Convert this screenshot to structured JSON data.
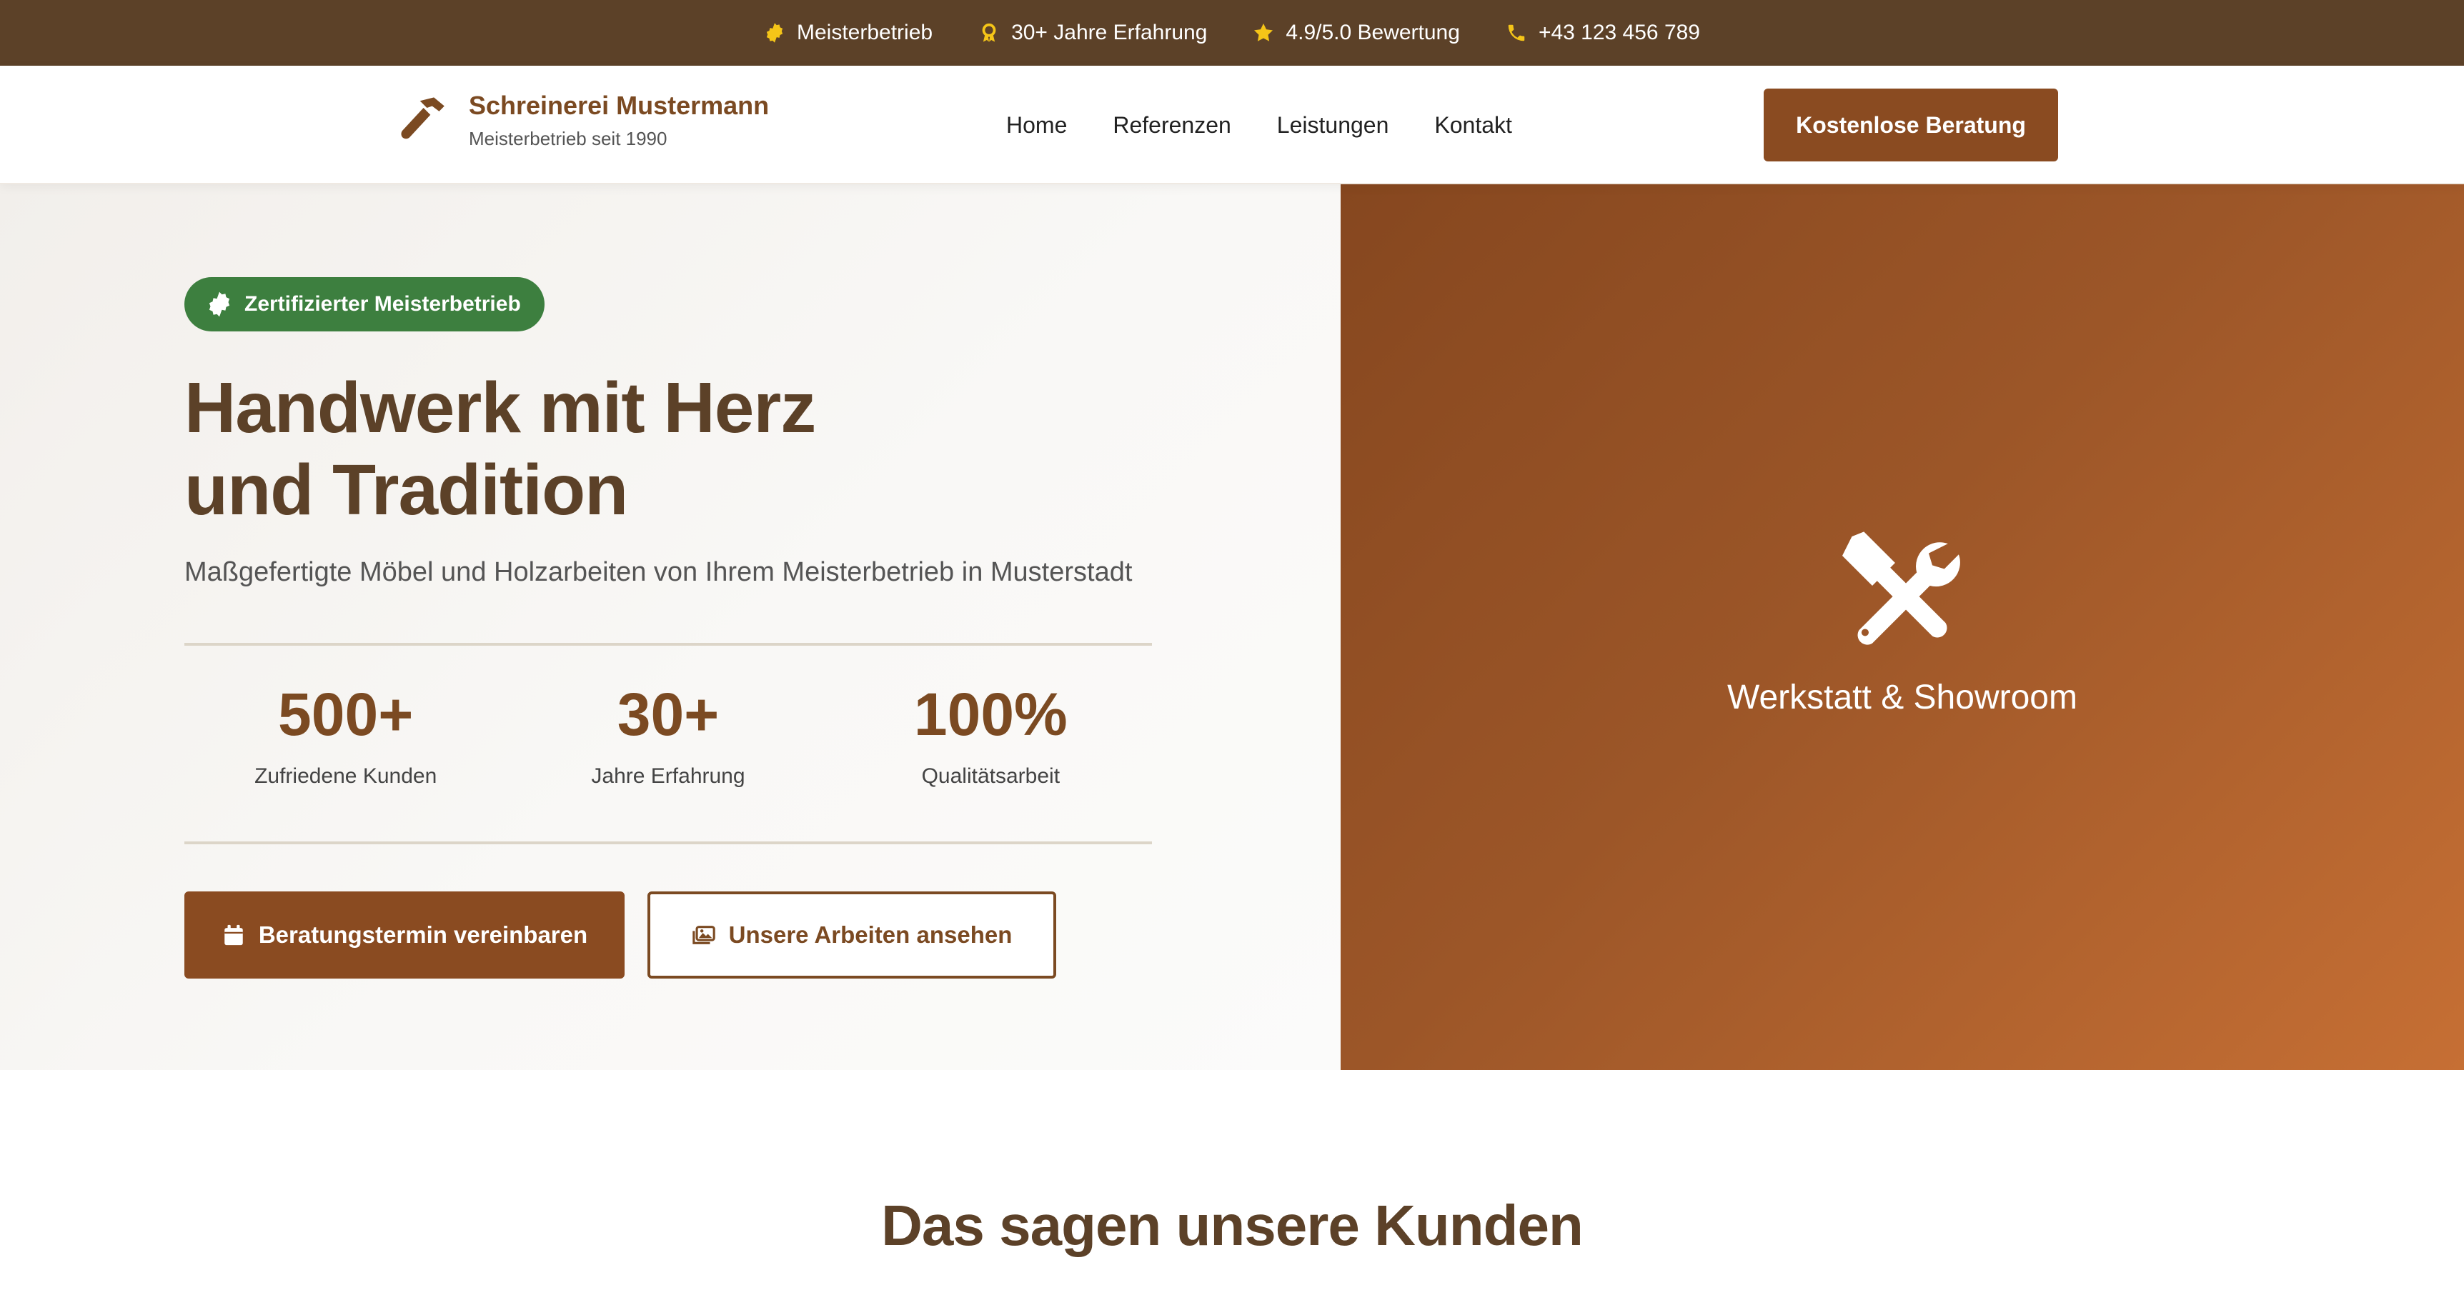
{
  "topbar": {
    "items": [
      {
        "icon": "certificate-icon",
        "label": "Meisterbetrieb"
      },
      {
        "icon": "award-icon",
        "label": "30+ Jahre Erfahrung"
      },
      {
        "icon": "star-icon",
        "label": "4.9/5.0 Bewertung"
      },
      {
        "icon": "phone-icon",
        "label": "+43 123 456 789"
      }
    ]
  },
  "header": {
    "logo_title": "Schreinerei Mustermann",
    "logo_subtitle": "Meisterbetrieb seit 1990",
    "nav": [
      "Home",
      "Referenzen",
      "Leistungen",
      "Kontakt"
    ],
    "cta_label": "Kostenlose Beratung"
  },
  "hero": {
    "badge": "Zertifizierter Meisterbetrieb",
    "title_line1": "Handwerk mit Herz",
    "title_line2": "und Tradition",
    "subtitle": "Maßgefertigte Möbel und Holzarbeiten von Ihrem Meisterbetrieb in Musterstadt",
    "stats": [
      {
        "value": "500+",
        "label": "Zufriedene Kunden"
      },
      {
        "value": "30+",
        "label": "Jahre Erfahrung"
      },
      {
        "value": "100%",
        "label": "Qualitätsarbeit"
      }
    ],
    "primary_button": "Beratungstermin vereinbaren",
    "secondary_button": "Unsere Arbeiten ansehen",
    "image_caption": "Werkstatt & Showroom"
  },
  "testimonials": {
    "title": "Das sagen unsere Kunden"
  },
  "colors": {
    "brand_brown": "#8a4b21",
    "dark_brown": "#5c4128",
    "badge_green": "#3d7f3f",
    "topbar_icon_yellow": "#f5c518"
  }
}
